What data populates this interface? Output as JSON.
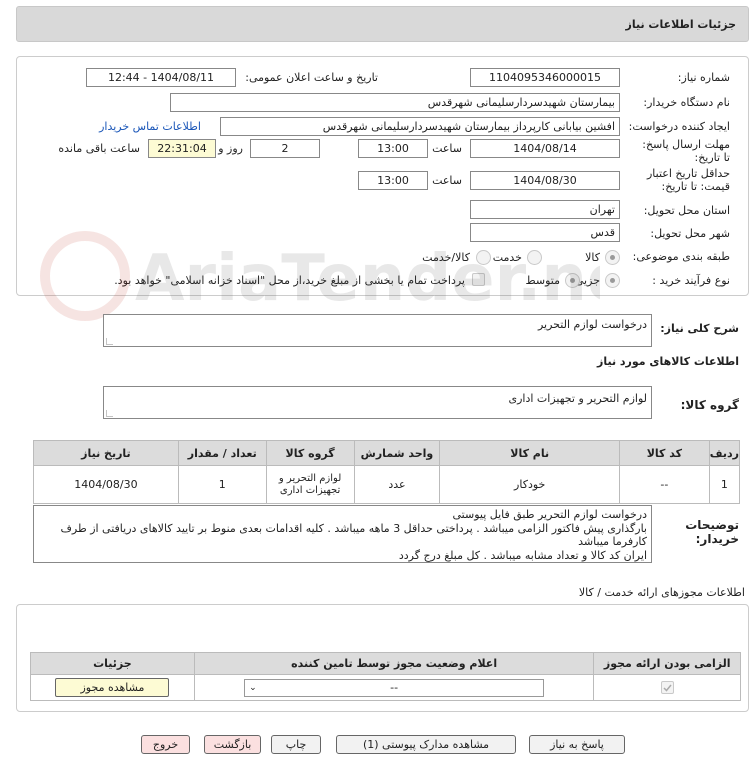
{
  "title": "جزئیات اطلاعات نیاز",
  "fields": {
    "need_number_label": "شماره نیاز:",
    "need_number": "1104095346000015",
    "announce_label": "تاریخ و ساعت اعلان عمومی:",
    "announce_value": "1404/08/11 - 12:44",
    "buyer_org_label": "نام دستگاه خریدار:",
    "buyer_org": "بیمارستان شهیدسردارسلیمانی شهرقدس",
    "creator_label": "ایجاد کننده درخواست:",
    "creator": "افشین بیابانی کارپرداز بیمارستان شهیدسردارسلیمانی شهرقدس",
    "contact_link": "اطلاعات تماس خریدار",
    "deadline_label": "مهلت ارسال پاسخ: تا تاریخ:",
    "deadline_date": "1404/08/14",
    "time_label": "ساعت",
    "deadline_time": "13:00",
    "days": "2",
    "days_label": "روز و",
    "remaining": "22:31:04",
    "remaining_label": "ساعت باقی مانده",
    "validity_label": "حداقل تاریخ اعتبار قیمت: تا تاریخ:",
    "validity_date": "1404/08/30",
    "validity_time": "13:00",
    "province_label": "استان محل تحویل:",
    "province": "تهران",
    "city_label": "شهر محل تحویل:",
    "city": "قدس",
    "category_label": "طبقه بندی موضوعی:",
    "cat_goods": "کالا",
    "cat_service": "خدمت",
    "cat_goods_service": "کالا/خدمت",
    "process_label": "نوع فرآیند خرید :",
    "proc_partial": "جزیی",
    "proc_medium": "متوسط",
    "payment_note": "پرداخت تمام یا بخشی از مبلغ خرید،از محل \"اسناد خزانه اسلامی\" خواهد بود."
  },
  "watermark": "AriaTender.net",
  "summary_label": "شرح کلی نیاز:",
  "summary": "درخواست لوازم التحریر",
  "goods_info_label": "اطلاعات کالاهای مورد نیاز",
  "goods_group_label": "گروه کالا:",
  "goods_group": "لوازم التحریر و تجهیزات اداری",
  "table": {
    "headers": [
      "ردیف",
      "کد کالا",
      "نام کالا",
      "واحد شمارش",
      "گروه کالا",
      "تعداد / مقدار",
      "تاریخ نیاز"
    ],
    "row": [
      "1",
      "--",
      "خودکار",
      "عدد",
      "لوازم التحریر و تجهیزات اداری",
      "1",
      "1404/08/30"
    ]
  },
  "buyer_notes_label": "توضیحات خریدار:",
  "buyer_notes": [
    "درخواست لوازم التحریر طبق فایل پیوستی",
    "بارگذاری پیش فاکتور الزامی میباشد . پرداختی حداقل 3 ماهه میباشد . کلیه اقدامات بعدی منوط بر تایید کالاهای دریافتی از طرف کارفرما میباشد",
    "ایران کد کالا و تعداد مشابه میباشد . کل مبلغ درج گردد"
  ],
  "permits_label": "اطلاعات مجوزهای ارائه خدمت / کالا",
  "permits_table": {
    "headers": [
      "الزامی بودن ارائه مجوز",
      "اعلام وضعیت مجوز توسط تامین کننده",
      "جزئیات"
    ],
    "select_value": "--",
    "view_button": "مشاهده مجوز"
  },
  "buttons": {
    "reply": "پاسخ به نیاز",
    "attachments": "مشاهده مدارک پیوستی (1)",
    "print": "چاپ",
    "back": "بازگشت",
    "exit": "خروج"
  },
  "colors": {
    "header_bg": "#d9d9d9",
    "highlight": "#fdfbd4",
    "link": "#1a56b8",
    "button_pink": "#fbe0e0"
  }
}
